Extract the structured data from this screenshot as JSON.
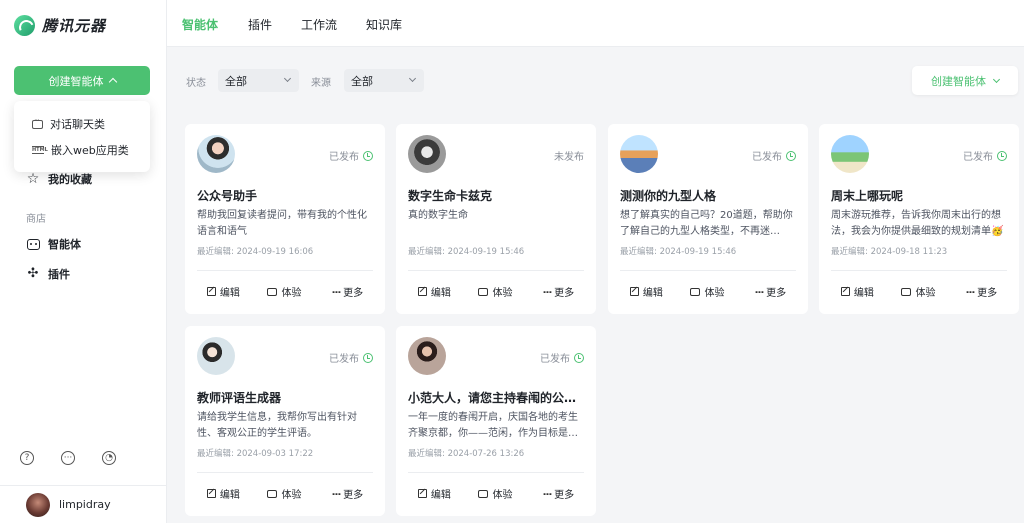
{
  "brand": {
    "name": "腾讯元器"
  },
  "sidebar": {
    "create_label": "创建智能体",
    "dropdown": [
      {
        "label": "对话聊天类",
        "icon": "chat-icon"
      },
      {
        "label": "嵌入web应用类",
        "icon": "html-icon"
      }
    ],
    "favorites_label": "我的收藏",
    "store_section": "商店",
    "nav": [
      {
        "label": "智能体",
        "icon": "robot-icon"
      },
      {
        "label": "插件",
        "icon": "puzzle-icon"
      }
    ],
    "footer_icons": [
      "help-icon",
      "message-icon",
      "wechat-icon"
    ],
    "user": {
      "name": "limpidray"
    }
  },
  "tabs": [
    {
      "label": "智能体",
      "active": true
    },
    {
      "label": "插件",
      "active": false
    },
    {
      "label": "工作流",
      "active": false
    },
    {
      "label": "知识库",
      "active": false
    }
  ],
  "filters": {
    "status_label": "状态",
    "status_value": "全部",
    "source_label": "来源",
    "source_value": "全部",
    "create_label": "创建智能体"
  },
  "accent_color": "#4cc172",
  "cards": [
    {
      "title": "公众号助手",
      "desc": "帮助我回复读者提问，带有我的个性化语言和语气",
      "status": "已发布",
      "published": true,
      "edited": "最近编辑: 2024-09-19 16:06",
      "edit": "编辑",
      "try": "体验",
      "more": "更多"
    },
    {
      "title": "数字生命卡兹克",
      "desc": "真的数字生命",
      "status": "未发布",
      "published": false,
      "edited": "最近编辑: 2024-09-19 15:46",
      "edit": "编辑",
      "try": "体验",
      "more": "更多"
    },
    {
      "title": "测测你的九型人格",
      "desc": "想了解真实的自己吗？20道题，帮助你了解自己的九型人格类型，不再迷…",
      "status": "已发布",
      "published": true,
      "edited": "最近编辑: 2024-09-19 15:46",
      "edit": "编辑",
      "try": "体验",
      "more": "更多"
    },
    {
      "title": "周末上哪玩呢",
      "desc": "周末游玩推荐，告诉我你周末出行的想法，我会为你提供最细致的规划清单🥳",
      "status": "已发布",
      "published": true,
      "edited": "最近编辑: 2024-09-18 11:23",
      "edit": "编辑",
      "try": "体验",
      "more": "更多"
    },
    {
      "title": "教师评语生成器",
      "desc": "请给我学生信息，我帮你写出有针对性、客观公正的学生评语。",
      "status": "已发布",
      "published": true,
      "edited": "最近编辑: 2024-09-03 17:22",
      "edit": "编辑",
      "try": "体验",
      "more": "更多"
    },
    {
      "title": "小范大人，请您主持春闱的公…",
      "desc": "一年一度的春闱开启，庆国各地的考生齐聚京都，你——范闲，作为目标是…",
      "status": "已发布",
      "published": true,
      "edited": "最近编辑: 2024-07-26 13:26",
      "edit": "编辑",
      "try": "体验",
      "more": "更多"
    }
  ]
}
